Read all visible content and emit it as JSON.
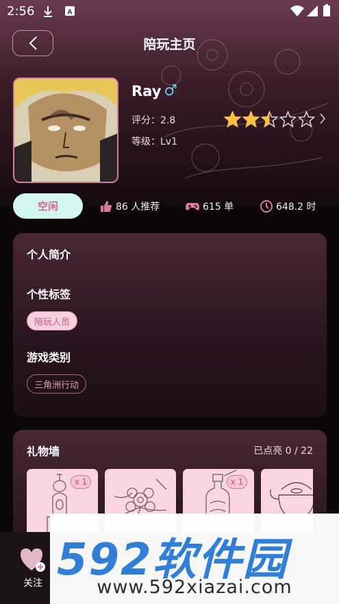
{
  "status_bar": {
    "time": "2:56"
  },
  "header": {
    "title": "陪玩主页"
  },
  "profile": {
    "name": "Ray",
    "gender_symbol": "♂",
    "rating_text": "评分：2.8",
    "rating_value": 2.8,
    "rating_max": 5,
    "level_text": "等级：Lv1"
  },
  "stats": {
    "status": "空闲",
    "recommend": "86 人推荐",
    "orders": "615 单",
    "hours": "648.2 时"
  },
  "intro": {
    "title": "个人简介",
    "tags_title": "个性标签",
    "tag": "陪玩人员",
    "games_title": "游戏类别",
    "game": "三角洲行动"
  },
  "gifts": {
    "title": "礼物墙",
    "lit_count": "已点亮 0 / 22",
    "items": [
      {
        "icon": "trophy-icon",
        "qty": "x 1"
      },
      {
        "icon": "flower-icon",
        "qty": ""
      },
      {
        "icon": "bottle-icon",
        "qty": "x 1"
      },
      {
        "icon": "teapot-icon",
        "qty": ""
      }
    ]
  },
  "bottom": {
    "follow_label": "关注"
  },
  "watermark": {
    "brand": "592软件园",
    "url": "www.592xiazai.com"
  },
  "colors": {
    "accent_pink": "#d87b9a",
    "status_bg": "#d3f8f3",
    "star_gold": "#f5c044",
    "gender_blue": "#67c9e0",
    "watermark_blue": "#2f7fd8"
  }
}
